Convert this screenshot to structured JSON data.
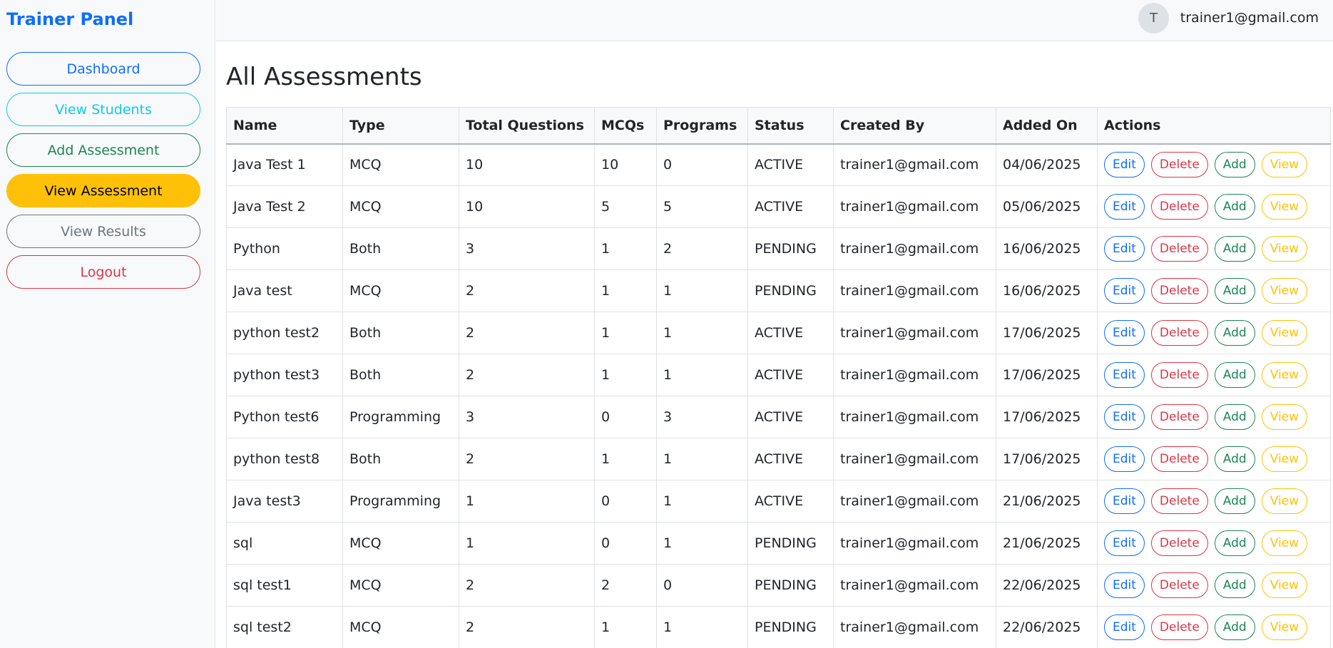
{
  "sidebar": {
    "brand": "Trainer Panel",
    "items": [
      {
        "label": "Dashboard"
      },
      {
        "label": "View Students"
      },
      {
        "label": "Add Assessment"
      },
      {
        "label": "View Assessment"
      },
      {
        "label": "View Results"
      },
      {
        "label": "Logout"
      }
    ]
  },
  "topbar": {
    "avatar_initial": "T",
    "user_email": "trainer1@gmail.com"
  },
  "main": {
    "title": "All Assessments",
    "columns": [
      "Name",
      "Type",
      "Total Questions",
      "MCQs",
      "Programs",
      "Status",
      "Created By",
      "Added On",
      "Actions"
    ],
    "action_labels": {
      "edit": "Edit",
      "delete": "Delete",
      "add": "Add",
      "view": "View"
    },
    "rows": [
      {
        "name": "Java Test 1",
        "type": "MCQ",
        "total": "10",
        "mcqs": "10",
        "programs": "0",
        "status": "ACTIVE",
        "created_by": "trainer1@gmail.com",
        "added_on": "04/06/2025"
      },
      {
        "name": "Java Test 2",
        "type": "MCQ",
        "total": "10",
        "mcqs": "5",
        "programs": "5",
        "status": "ACTIVE",
        "created_by": "trainer1@gmail.com",
        "added_on": "05/06/2025"
      },
      {
        "name": "Python",
        "type": "Both",
        "total": "3",
        "mcqs": "1",
        "programs": "2",
        "status": "PENDING",
        "created_by": "trainer1@gmail.com",
        "added_on": "16/06/2025"
      },
      {
        "name": "Java test",
        "type": "MCQ",
        "total": "2",
        "mcqs": "1",
        "programs": "1",
        "status": "PENDING",
        "created_by": "trainer1@gmail.com",
        "added_on": "16/06/2025"
      },
      {
        "name": "python test2",
        "type": "Both",
        "total": "2",
        "mcqs": "1",
        "programs": "1",
        "status": "ACTIVE",
        "created_by": "trainer1@gmail.com",
        "added_on": "17/06/2025"
      },
      {
        "name": "python test3",
        "type": "Both",
        "total": "2",
        "mcqs": "1",
        "programs": "1",
        "status": "ACTIVE",
        "created_by": "trainer1@gmail.com",
        "added_on": "17/06/2025"
      },
      {
        "name": "Python test6",
        "type": "Programming",
        "total": "3",
        "mcqs": "0",
        "programs": "3",
        "status": "ACTIVE",
        "created_by": "trainer1@gmail.com",
        "added_on": "17/06/2025"
      },
      {
        "name": "python test8",
        "type": "Both",
        "total": "2",
        "mcqs": "1",
        "programs": "1",
        "status": "ACTIVE",
        "created_by": "trainer1@gmail.com",
        "added_on": "17/06/2025"
      },
      {
        "name": "Java test3",
        "type": "Programming",
        "total": "1",
        "mcqs": "0",
        "programs": "1",
        "status": "ACTIVE",
        "created_by": "trainer1@gmail.com",
        "added_on": "21/06/2025"
      },
      {
        "name": "sql",
        "type": "MCQ",
        "total": "1",
        "mcqs": "0",
        "programs": "1",
        "status": "PENDING",
        "created_by": "trainer1@gmail.com",
        "added_on": "21/06/2025"
      },
      {
        "name": "sql test1",
        "type": "MCQ",
        "total": "2",
        "mcqs": "2",
        "programs": "0",
        "status": "PENDING",
        "created_by": "trainer1@gmail.com",
        "added_on": "22/06/2025"
      },
      {
        "name": "sql test2",
        "type": "MCQ",
        "total": "2",
        "mcqs": "1",
        "programs": "1",
        "status": "PENDING",
        "created_by": "trainer1@gmail.com",
        "added_on": "22/06/2025"
      }
    ]
  },
  "colors": {
    "primary": "#0d6efd",
    "info": "#0dcaf0",
    "success": "#198754",
    "warning": "#ffc107",
    "secondary": "#6c757d",
    "danger": "#dc3545"
  }
}
